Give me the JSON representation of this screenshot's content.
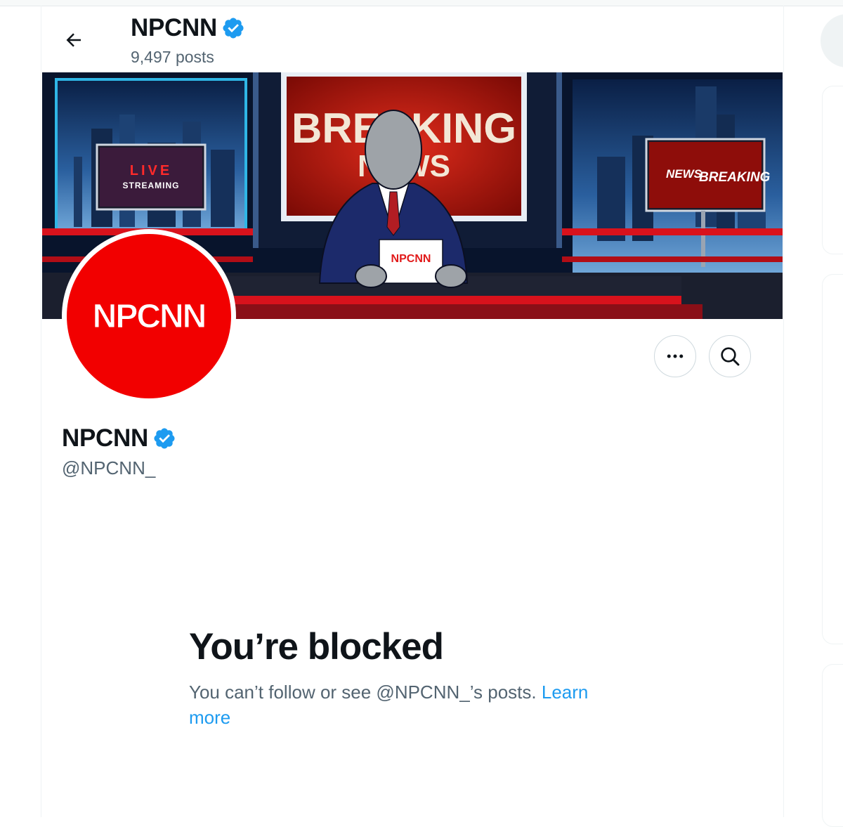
{
  "header": {
    "account_name": "NPCNN",
    "posts_count": "9,497 posts"
  },
  "banner": {
    "headline_top": "BREAKING",
    "headline_bottom": "NEWS",
    "left_screen_line1": "LIVE",
    "left_screen_line2": "STREAMING",
    "right_screen_word1": "NEWS",
    "right_screen_word2": "BREAKING",
    "desk_card_text": "NPCNN"
  },
  "avatar": {
    "logo_text": "NPCNN"
  },
  "profile": {
    "display_name": "NPCNN",
    "handle": "@NPCNN_"
  },
  "blocked": {
    "title": "You’re blocked",
    "message": "You can’t follow or see @NPCNN_’s posts. ",
    "link": "Learn more"
  },
  "colors": {
    "verified_badge": "#1d9bf0",
    "link": "#1d9bf0",
    "avatar_bg": "#f20000",
    "secondary_text": "#536471"
  },
  "icons": [
    "back-arrow-icon",
    "verified-badge-icon",
    "more-icon",
    "search-icon"
  ]
}
